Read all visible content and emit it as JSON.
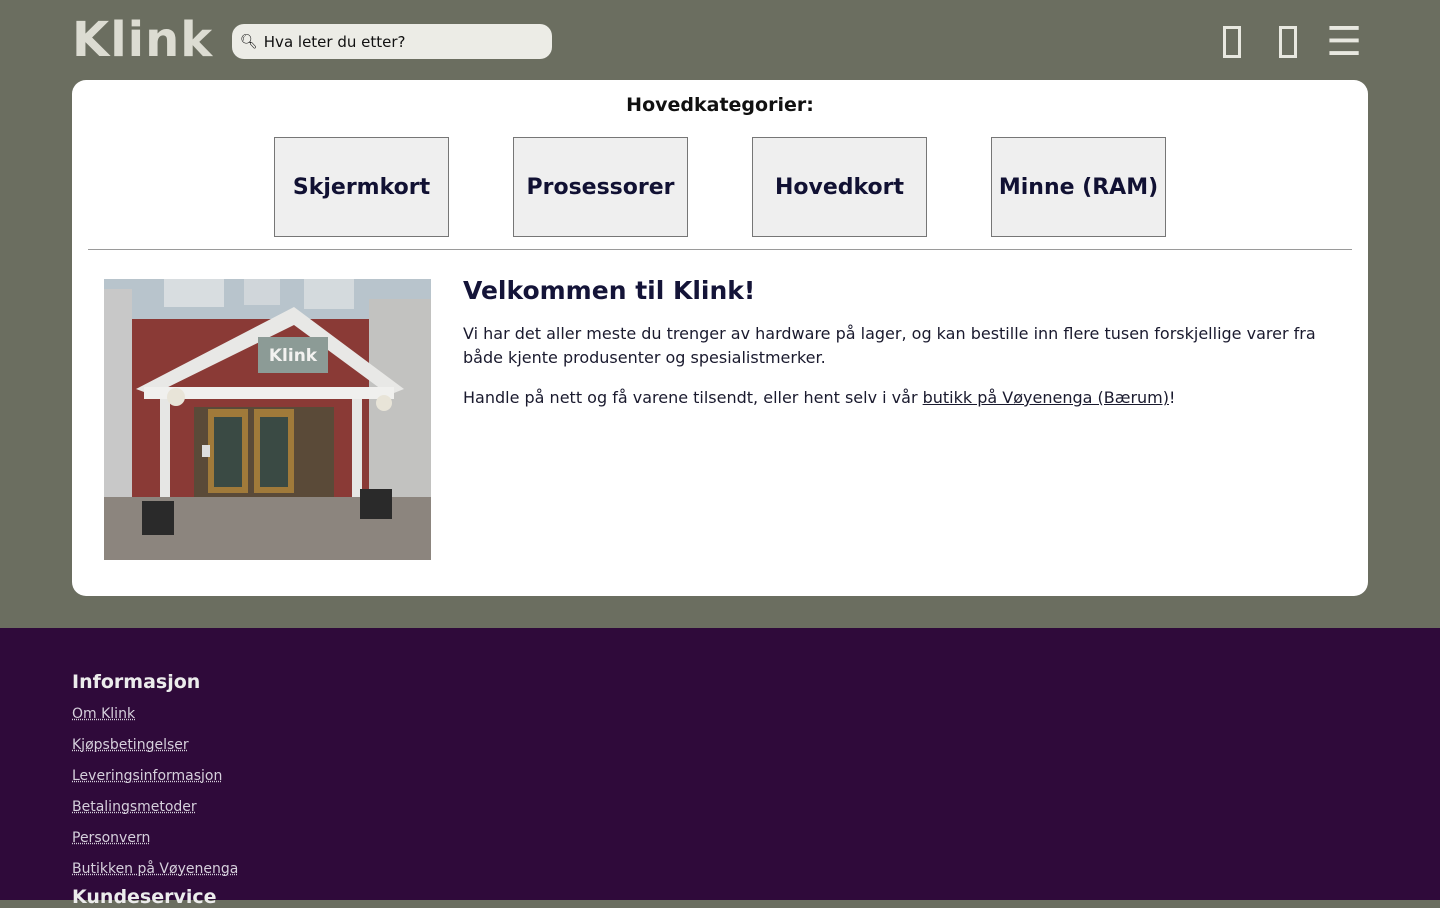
{
  "header": {
    "logo": "Klink",
    "search_placeholder": "Hva leter du etter?",
    "search_icon": "search-icon",
    "icons": [
      "user-icon",
      "cart-icon",
      "menu-icon"
    ]
  },
  "categories": {
    "title": "Hovedkategorier:",
    "items": [
      "Skjermkort",
      "Prosessorer",
      "Hovedkort",
      "Minne (RAM)"
    ]
  },
  "welcome": {
    "heading": "Velkommen til Klink!",
    "paragraph1": "Vi har det aller meste du trenger av hardware på lager, og kan bestille inn flere tusen forskjellige varer fra både kjente produsenter og spesialistmerker.",
    "paragraph2_before": "Handle på nett og få varene tilsendt, eller hent selv i vår ",
    "paragraph2_link": "butikk på Vøyenenga (Bærum)",
    "paragraph2_after": "!",
    "photo_sign": "Klink"
  },
  "footer": {
    "info_heading": "Informasjon",
    "info_links": [
      "Om Klink",
      "Kjøpsbetingelser",
      "Leveringsinformasjon",
      "Betalingsmetoder",
      "Personvern",
      "Butikken på Vøyenenga"
    ],
    "service_heading": "Kundeservice"
  },
  "colors": {
    "header_bg": "#6b6e60",
    "footer_bg": "#2f0a3a",
    "text_dark": "#141438"
  }
}
